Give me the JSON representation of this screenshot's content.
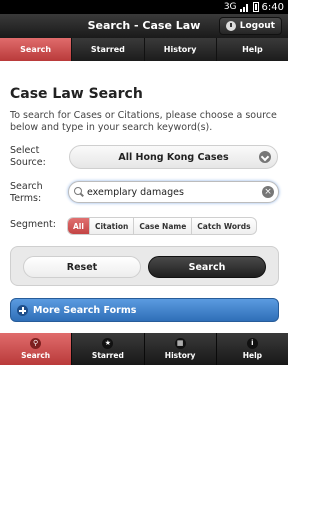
{
  "status_bar": {
    "network": "3G",
    "time": "6:40"
  },
  "title_bar": {
    "title": "Search - Case Law",
    "logout_label": "Logout"
  },
  "top_tabs": [
    {
      "label": "Search",
      "active": true
    },
    {
      "label": "Starred",
      "active": false
    },
    {
      "label": "History",
      "active": false
    },
    {
      "label": "Help",
      "active": false
    }
  ],
  "main": {
    "heading": "Case Law Search",
    "description": "To search for Cases or Citations, please choose a source below and type in your search keyword(s).",
    "source": {
      "label": "Select Source:",
      "value": "All Hong Kong Cases"
    },
    "terms": {
      "label": "Search Terms:",
      "value": "exemplary damages"
    },
    "segment": {
      "label": "Segment:",
      "options": [
        "All",
        "Citation",
        "Case Name",
        "Catch Words"
      ],
      "selected": "All"
    },
    "reset_label": "Reset",
    "search_label": "Search",
    "more_label": "More Search Forms"
  },
  "bottom_nav": [
    {
      "label": "Search",
      "icon": "search-icon",
      "active": true
    },
    {
      "label": "Starred",
      "icon": "star-icon",
      "active": false
    },
    {
      "label": "History",
      "icon": "history-icon",
      "active": false
    },
    {
      "label": "Help",
      "icon": "info-icon",
      "active": false
    }
  ],
  "colors": {
    "accent_red": "#c44444",
    "more_blue": "#3a7cc4",
    "dark_bar": "#1f1f1f"
  }
}
